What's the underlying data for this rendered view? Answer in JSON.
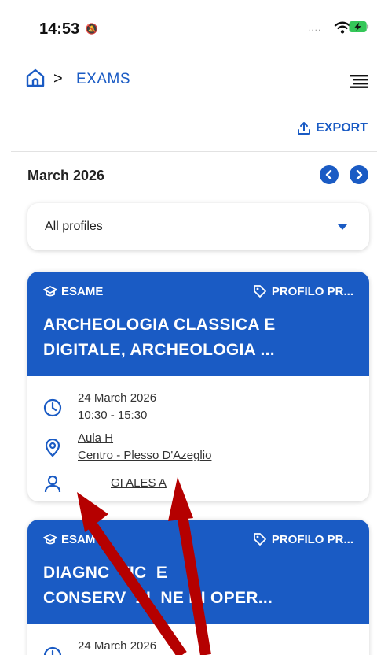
{
  "status_bar": {
    "time": "14:53",
    "silent_icon": "bell-slash-icon",
    "signal_dots": "....",
    "wifi_icon": "wifi-icon",
    "battery_icon": "battery-charging-icon"
  },
  "nav": {
    "home_icon": "home-icon",
    "separator": ">",
    "crumb": "EXAMS",
    "menu_icon": "menu-icon"
  },
  "toolbar": {
    "export_label": "EXPORT",
    "export_icon": "upload-icon"
  },
  "calendar": {
    "month": "March 2026",
    "prev_icon": "chevron-left-icon",
    "next_icon": "chevron-right-icon"
  },
  "filter": {
    "selected": "All profiles"
  },
  "exams": [
    {
      "type_label": "ESAME",
      "profile_label": "PROFILO PR...",
      "title_line1": "ARCHEOLOGIA CLASSICA E",
      "title_line2": "DIGITALE, ARCHEOLOGIA ...",
      "date": "24 March 2026",
      "time": "10:30 - 15:30",
      "room": "Aula H",
      "location": "Centro - Plesso D'Azeglio",
      "teacher": "GI ALES A"
    },
    {
      "type_label": "ESAM",
      "profile_label": "PROFILO PR...",
      "title_line1": "DIAGNC  TIC  E",
      "title_line2": "CONSERV  ZI  NE DI OPER...",
      "date": "24 March 2026"
    }
  ],
  "colors": {
    "primary": "#1a5bc4",
    "annotation_arrow": "#b50000"
  }
}
